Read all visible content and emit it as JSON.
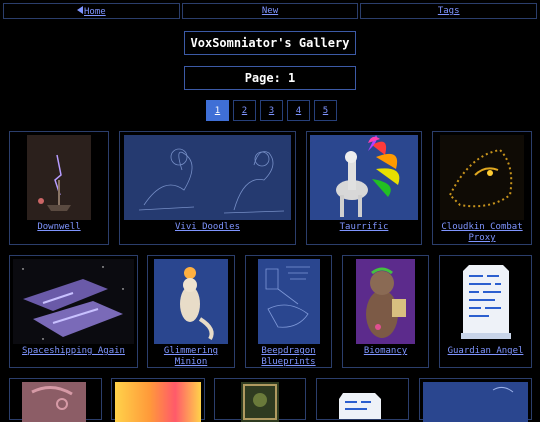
{
  "nav": {
    "home": "Home",
    "new": "New",
    "tags": "Tags"
  },
  "gallery_title": "VoxSomniator's Gallery",
  "page_label": "Page: 1",
  "pagination": [
    "1",
    "2",
    "3",
    "4",
    "5"
  ],
  "current_page": "1",
  "items": [
    {
      "title": "Downwell"
    },
    {
      "title": "Vivi Doodles"
    },
    {
      "title": "Taurrific"
    },
    {
      "title": "Cloudkin Combat Proxy"
    },
    {
      "title": "Spaceshipping Again"
    },
    {
      "title": "Glimmering Minion"
    },
    {
      "title": "Beepdragon Blueprints"
    },
    {
      "title": "Biomancy"
    },
    {
      "title": "Guardian Angel"
    }
  ]
}
